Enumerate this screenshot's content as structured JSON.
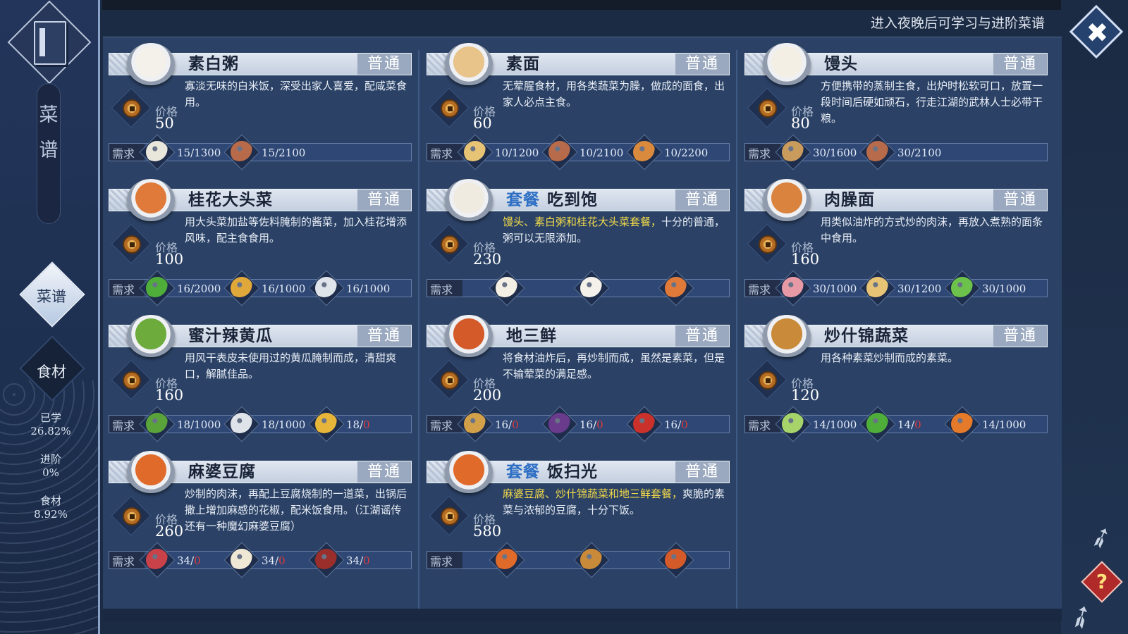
{
  "sidebar": {
    "vertical_title": [
      "菜",
      "谱"
    ],
    "nav_recipes": "菜谱",
    "nav_ingredients": "食材",
    "stats": [
      {
        "label": "已学",
        "value": "26.82%"
      },
      {
        "label": "进阶",
        "value": "0%"
      },
      {
        "label": "食材",
        "value": "8.92%"
      }
    ]
  },
  "header": {
    "notice": "进入夜晚后可学习与进阶菜谱",
    "close_icon": "✖"
  },
  "help_icon": "?",
  "labels": {
    "price": "价格",
    "require": "需求",
    "set_tag": "套餐"
  },
  "colors": {
    "highlight": "#f2d94a",
    "set_tag": "#2e6fc4",
    "insufficient": "#e03a3a"
  },
  "recipes": [
    {
      "name": "素白粥",
      "tag": "",
      "tier": "普通",
      "desc": "寡淡无味的白米饭，深受出家人喜爱，配咸菜食用。",
      "highlight": "",
      "price": "50",
      "dish_color": "#f3f1ea",
      "requirements": [
        {
          "icon": "rice-grain-icon",
          "color": "#e9e6dc",
          "have": "15",
          "need": "/1300"
        },
        {
          "icon": "water-bucket-icon",
          "color": "#b76b4a",
          "have": "15",
          "need": "/2100"
        }
      ]
    },
    {
      "name": "素面",
      "tag": "",
      "tier": "普通",
      "desc": "无荤腥食材，用各类蔬菜为臊，做成的面食，出家人必点主食。",
      "highlight": "",
      "price": "60",
      "dish_color": "#e8c48a",
      "requirements": [
        {
          "icon": "noodles-icon",
          "color": "#e6c375",
          "have": "10",
          "need": "/1200"
        },
        {
          "icon": "water-bucket-icon",
          "color": "#b76b4a",
          "have": "10",
          "need": "/2100"
        },
        {
          "icon": "tofu-block-icon",
          "color": "#d98a3c",
          "have": "10",
          "need": "/2200"
        }
      ]
    },
    {
      "name": "馒头",
      "tag": "",
      "tier": "普通",
      "desc": "方便携带的蒸制主食，出炉时松软可口，放置一段时间后硬如顽石，行走江湖的武林人士必带干粮。",
      "highlight": "",
      "price": "80",
      "dish_color": "#f4efe4",
      "requirements": [
        {
          "icon": "flour-sack-icon",
          "color": "#c99b5c",
          "have": "30",
          "need": "/1600"
        },
        {
          "icon": "water-bucket-icon",
          "color": "#b76b4a",
          "have": "30",
          "need": "/2100"
        }
      ]
    },
    {
      "name": "桂花大头菜",
      "tag": "",
      "tier": "普通",
      "desc": "用大头菜加盐等佐料腌制的酱菜，加入桂花增添风味，配主食食用。",
      "highlight": "",
      "price": "100",
      "dish_color": "#e07a3a",
      "requirements": [
        {
          "icon": "turnip-icon",
          "color": "#4fae3a",
          "have": "16",
          "need": "/2000"
        },
        {
          "icon": "osmanthus-icon",
          "color": "#e0a83a",
          "have": "16",
          "need": "/1000"
        },
        {
          "icon": "salt-icon",
          "color": "#dfe3ea",
          "have": "16",
          "need": "/1000"
        }
      ]
    },
    {
      "name": "吃到饱",
      "tag": "套餐",
      "tier": "普通",
      "desc": "，粥可以无限添加。",
      "highlight": "馒头、素白粥和桂花大头菜套餐，",
      "highlight_tail": "十分的普通",
      "price": "230",
      "dish_color": "#f0ebe0",
      "requirements": [
        {
          "icon": "steamed-bun-icon",
          "color": "#f4efe4",
          "have": "",
          "need": ""
        },
        {
          "icon": "rice-porridge-icon",
          "color": "#f3f1ea",
          "have": "",
          "need": ""
        },
        {
          "icon": "pickled-turnip-icon",
          "color": "#e07a3a",
          "have": "",
          "need": ""
        }
      ]
    },
    {
      "name": "肉臊面",
      "tag": "",
      "tier": "普通",
      "desc": "用类似油炸的方式炒的肉沫，再放入煮熟的面条中食用。",
      "highlight": "",
      "price": "160",
      "dish_color": "#d9833e",
      "requirements": [
        {
          "icon": "pork-icon",
          "color": "#e79aa5",
          "have": "30",
          "need": "/1000"
        },
        {
          "icon": "noodles-icon",
          "color": "#e6c375",
          "have": "30",
          "need": "/1200"
        },
        {
          "icon": "scallion-icon",
          "color": "#6cc24a",
          "have": "30",
          "need": "/1000"
        }
      ]
    },
    {
      "name": "蜜汁辣黄瓜",
      "tag": "",
      "tier": "普通",
      "desc": "用风干表皮未使用过的黄瓜腌制而成，清甜爽口，解腻佳品。",
      "highlight": "",
      "price": "160",
      "dish_color": "#6cab3c",
      "requirements": [
        {
          "icon": "cucumber-icon",
          "color": "#5aa33a",
          "have": "18",
          "need": "/1000"
        },
        {
          "icon": "salt-icon",
          "color": "#dfe3ea",
          "have": "18",
          "need": "/1000"
        },
        {
          "icon": "honey-icon",
          "color": "#e6b53a",
          "have": "18",
          "need": "/",
          "zero": "0"
        }
      ]
    },
    {
      "name": "地三鲜",
      "tag": "",
      "tier": "普通",
      "desc": "将食材油炸后，再炒制而成，虽然是素菜，但是不输荤菜的满足感。",
      "highlight": "",
      "price": "200",
      "dish_color": "#d45a2a",
      "requirements": [
        {
          "icon": "potato-icon",
          "color": "#d3a04a",
          "have": "16",
          "need": "/",
          "zero": "0"
        },
        {
          "icon": "eggplant-icon",
          "color": "#6a3a8c",
          "have": "16",
          "need": "/",
          "zero": "0"
        },
        {
          "icon": "chili-icon",
          "color": "#c9312a",
          "have": "16",
          "need": "/",
          "zero": "0"
        }
      ]
    },
    {
      "name": "炒什锦蔬菜",
      "tag": "",
      "tier": "普通",
      "desc": "用各种素菜炒制而成的素菜。",
      "highlight": "",
      "price": "120",
      "dish_color": "#c98a3a",
      "requirements": [
        {
          "icon": "cabbage-icon",
          "color": "#a6d46a",
          "have": "14",
          "need": "/1000"
        },
        {
          "icon": "lettuce-icon",
          "color": "#4fae3a",
          "have": "14",
          "need": "/",
          "zero": "0"
        },
        {
          "icon": "carrot-icon",
          "color": "#e47a2a",
          "have": "14",
          "need": "/1000"
        }
      ]
    },
    {
      "name": "麻婆豆腐",
      "tag": "",
      "tier": "普通",
      "desc": "炒制的肉沫，再配上豆腐烧制的一道菜，出锅后撒上增加麻感的花椒，配米饭食用。（江湖谣传还有一种魔幻麻婆豆腐）",
      "highlight": "",
      "price": "260",
      "dish_color": "#e06a2a",
      "requirements": [
        {
          "icon": "beef-icon",
          "color": "#c9424a",
          "have": "34",
          "need": "/",
          "zero": "0"
        },
        {
          "icon": "tofu-icon",
          "color": "#efe8d4",
          "have": "34",
          "need": "/",
          "zero": "0"
        },
        {
          "icon": "sichuan-pepper-icon",
          "color": "#9a2e2a",
          "have": "34",
          "need": "/",
          "zero": "0"
        }
      ]
    },
    {
      "name": "饭扫光",
      "tag": "套餐",
      "tier": "普通",
      "desc": "素菜与浓郁的豆腐，十分下饭。",
      "highlight": "麻婆豆腐、炒什锦蔬菜和地三鲜套餐，",
      "highlight_tail": "爽脆的",
      "price": "580",
      "dish_color": "#e06a2a",
      "requirements": [
        {
          "icon": "mapo-tofu-icon",
          "color": "#e06a2a",
          "have": "",
          "need": ""
        },
        {
          "icon": "stir-fried-vegetables-icon",
          "color": "#c98a3a",
          "have": "",
          "need": ""
        },
        {
          "icon": "di-san-xian-icon",
          "color": "#d45a2a",
          "have": "",
          "need": ""
        }
      ]
    }
  ]
}
